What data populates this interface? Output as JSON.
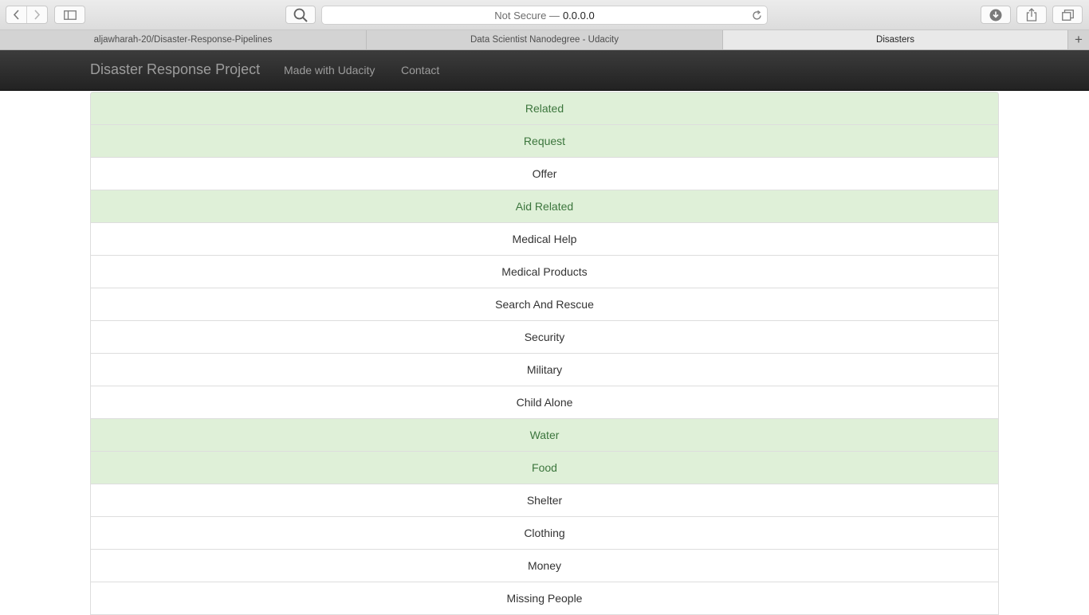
{
  "browser": {
    "address": {
      "security_label": "Not Secure —",
      "host": "0.0.0.0"
    },
    "tabs": [
      {
        "label": "aljawharah-20/Disaster-Response-Pipelines",
        "active": false
      },
      {
        "label": "Data Scientist Nanodegree - Udacity",
        "active": false
      },
      {
        "label": "Disasters",
        "active": true
      }
    ],
    "new_tab_label": "+"
  },
  "navbar": {
    "brand": "Disaster Response Project",
    "links": [
      "Made with Udacity",
      "Contact"
    ]
  },
  "categories": [
    {
      "label": "Related",
      "matched": true
    },
    {
      "label": "Request",
      "matched": true
    },
    {
      "label": "Offer",
      "matched": false
    },
    {
      "label": "Aid Related",
      "matched": true
    },
    {
      "label": "Medical Help",
      "matched": false
    },
    {
      "label": "Medical Products",
      "matched": false
    },
    {
      "label": "Search And Rescue",
      "matched": false
    },
    {
      "label": "Security",
      "matched": false
    },
    {
      "label": "Military",
      "matched": false
    },
    {
      "label": "Child Alone",
      "matched": false
    },
    {
      "label": "Water",
      "matched": true
    },
    {
      "label": "Food",
      "matched": true
    },
    {
      "label": "Shelter",
      "matched": false
    },
    {
      "label": "Clothing",
      "matched": false
    },
    {
      "label": "Money",
      "matched": false
    },
    {
      "label": "Missing People",
      "matched": false
    }
  ],
  "colors": {
    "matched_bg": "#dff0d8",
    "matched_text": "#3c763d",
    "navbar": "#222222"
  }
}
